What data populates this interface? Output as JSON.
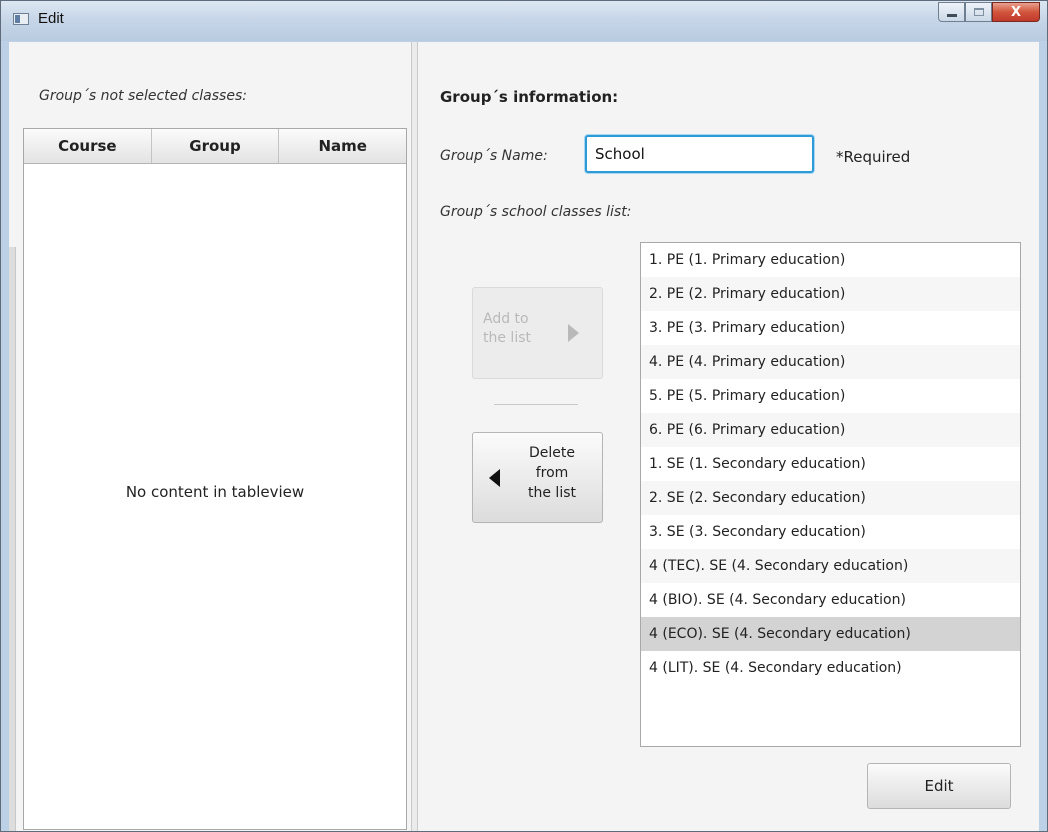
{
  "window": {
    "title": "Edit",
    "close_glyph": "X"
  },
  "left": {
    "label": "Group´s not selected classes:",
    "columns": [
      "Course",
      "Group",
      "Name"
    ],
    "placeholder": "No content in tableview"
  },
  "right": {
    "section_title": "Group´s information:",
    "name_label": "Group´s Name:",
    "name_value": "School",
    "required_note": "*Required",
    "list_label": "Group´s school classes list:",
    "add_button": "Add to\nthe list",
    "delete_button": "Delete\nfrom\nthe list",
    "edit_button": "Edit",
    "classes": [
      "1. PE (1. Primary education)",
      "2. PE (2. Primary education)",
      "3. PE (3. Primary education)",
      "4. PE (4. Primary education)",
      "5. PE (5. Primary education)",
      "6. PE (6. Primary education)",
      "1. SE (1. Secondary education)",
      "2. SE (2. Secondary education)",
      "3. SE (3. Secondary education)",
      "4 (TEC). SE (4. Secondary education)",
      "4 (BIO). SE (4. Secondary education)",
      "4 (ECO). SE (4. Secondary education)",
      "4 (LIT). SE (4. Secondary education)"
    ],
    "selected_index": 11
  },
  "colors": {
    "focus_border": "#2e9bd6",
    "selected_row": "#d3d3d3",
    "close_button": "#c0392b"
  },
  "icons": {
    "add_arrow": "triangle-right-icon",
    "delete_arrow": "triangle-left-icon"
  }
}
